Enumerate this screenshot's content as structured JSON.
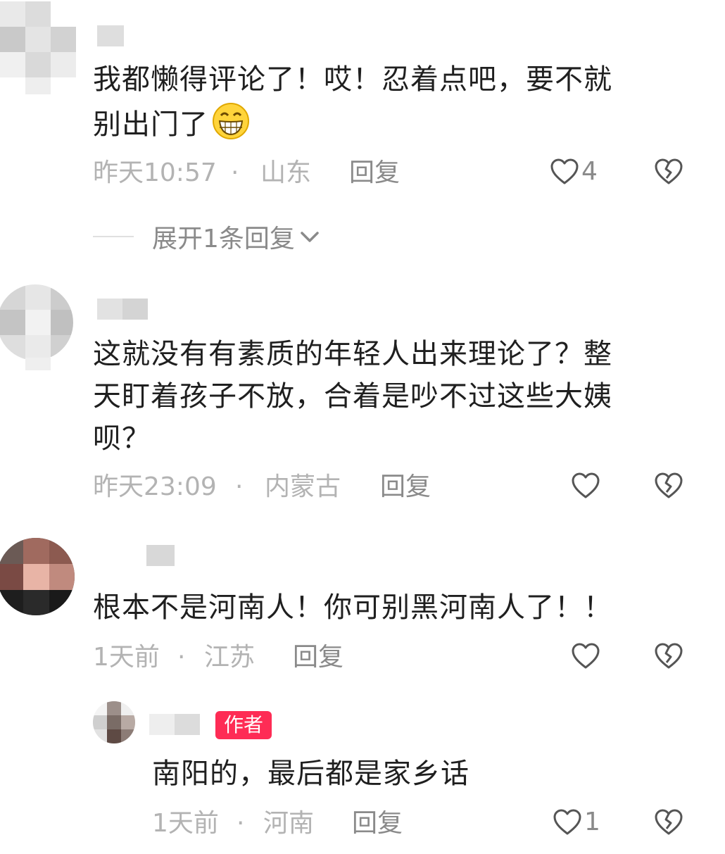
{
  "comments": [
    {
      "text_lines": [
        "我都懒得评论了！哎！忍着点吧，要不就",
        "别出门了"
      ],
      "emoji": "grinning-face-emoji",
      "time": "昨天10:57",
      "separator": "·",
      "location": "山东",
      "reply_label": "回复",
      "like_count": "4",
      "expand_label": "展开1条回复"
    },
    {
      "text_lines": [
        "这就没有有素质的年轻人出来理论了？整",
        "天盯着孩子不放，合着是吵不过这些大姨",
        "呗？"
      ],
      "time": "昨天23:09",
      "separator": "·",
      "location": "内蒙古",
      "reply_label": "回复",
      "like_count": ""
    },
    {
      "text_lines": [
        "根本不是河南人！你可别黑河南人了！！"
      ],
      "time": "1天前",
      "separator": "·",
      "location": "江苏",
      "reply_label": "回复",
      "like_count": ""
    }
  ],
  "reply": {
    "author_tag": "作者",
    "text": "南阳的，最后都是家乡话",
    "time": "1天前",
    "separator": "·",
    "location": "河南",
    "reply_label": "回复",
    "like_count": "1"
  },
  "colors": {
    "text": "#1f1f1f",
    "meta": "#b3b3b3",
    "action": "#8a8a8a",
    "author_tag": "#fe2c55",
    "icon_stroke": "#555555"
  },
  "icons": {
    "like": "heart-outline-icon",
    "dislike": "broken-heart-icon",
    "expand": "chevron-down-icon",
    "emoji": "grinning-face-emoji"
  }
}
